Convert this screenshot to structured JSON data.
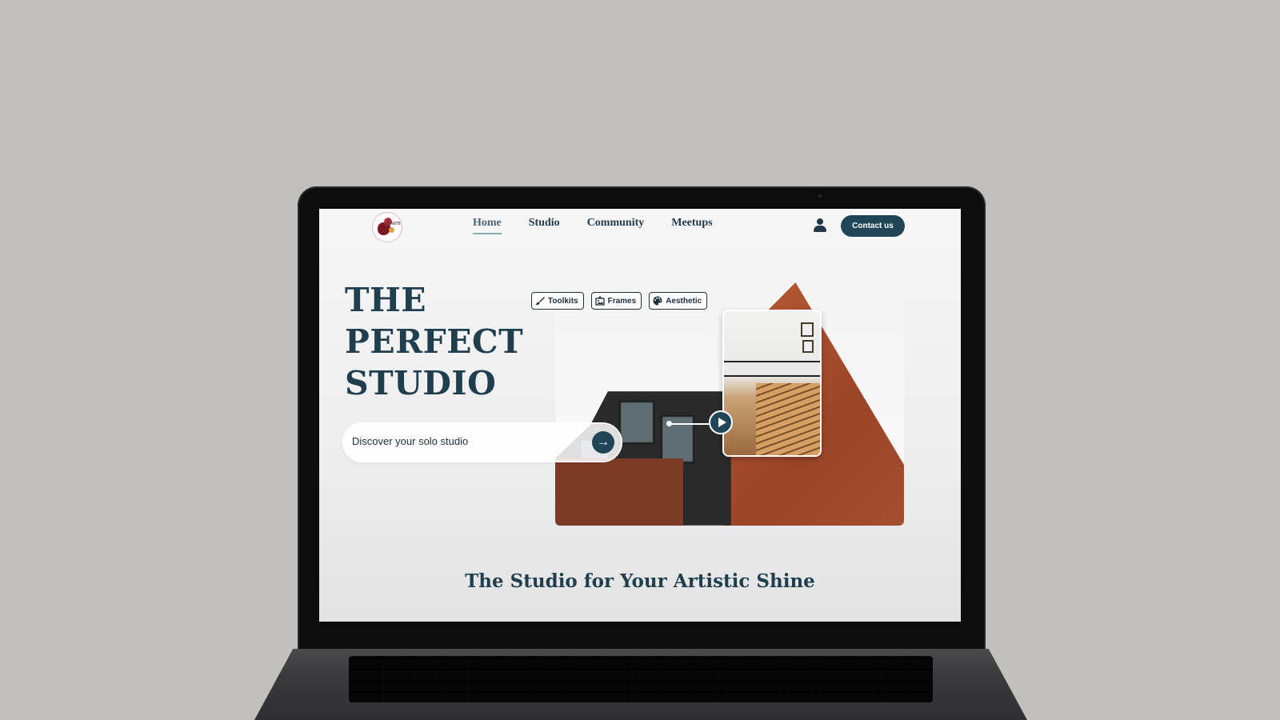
{
  "logo": {
    "text": "Exen"
  },
  "nav": {
    "items": [
      {
        "label": "Home",
        "active": true
      },
      {
        "label": "Studio",
        "active": false
      },
      {
        "label": "Community",
        "active": false
      },
      {
        "label": "Meetups",
        "active": false
      }
    ]
  },
  "header": {
    "contact_label": "Contact us",
    "user_icon": "user-icon"
  },
  "hero": {
    "title_lines": [
      "THE",
      "PERFECT",
      "STUDIO"
    ],
    "discover_text": "Discover your solo studio",
    "discover_icon": "arrow-right-icon",
    "chips": [
      {
        "label": "Toolkits",
        "icon": "paintbrush-icon"
      },
      {
        "label": "Frames",
        "icon": "frame-icon"
      },
      {
        "label": "Aesthetic",
        "icon": "palette-icon"
      }
    ],
    "play_icon": "play-icon"
  },
  "section": {
    "title": "The Studio for Your Artistic Shine"
  },
  "colors": {
    "accent": "#1f4556",
    "heading": "#1f3f4f",
    "background": "#c2c0bc"
  }
}
